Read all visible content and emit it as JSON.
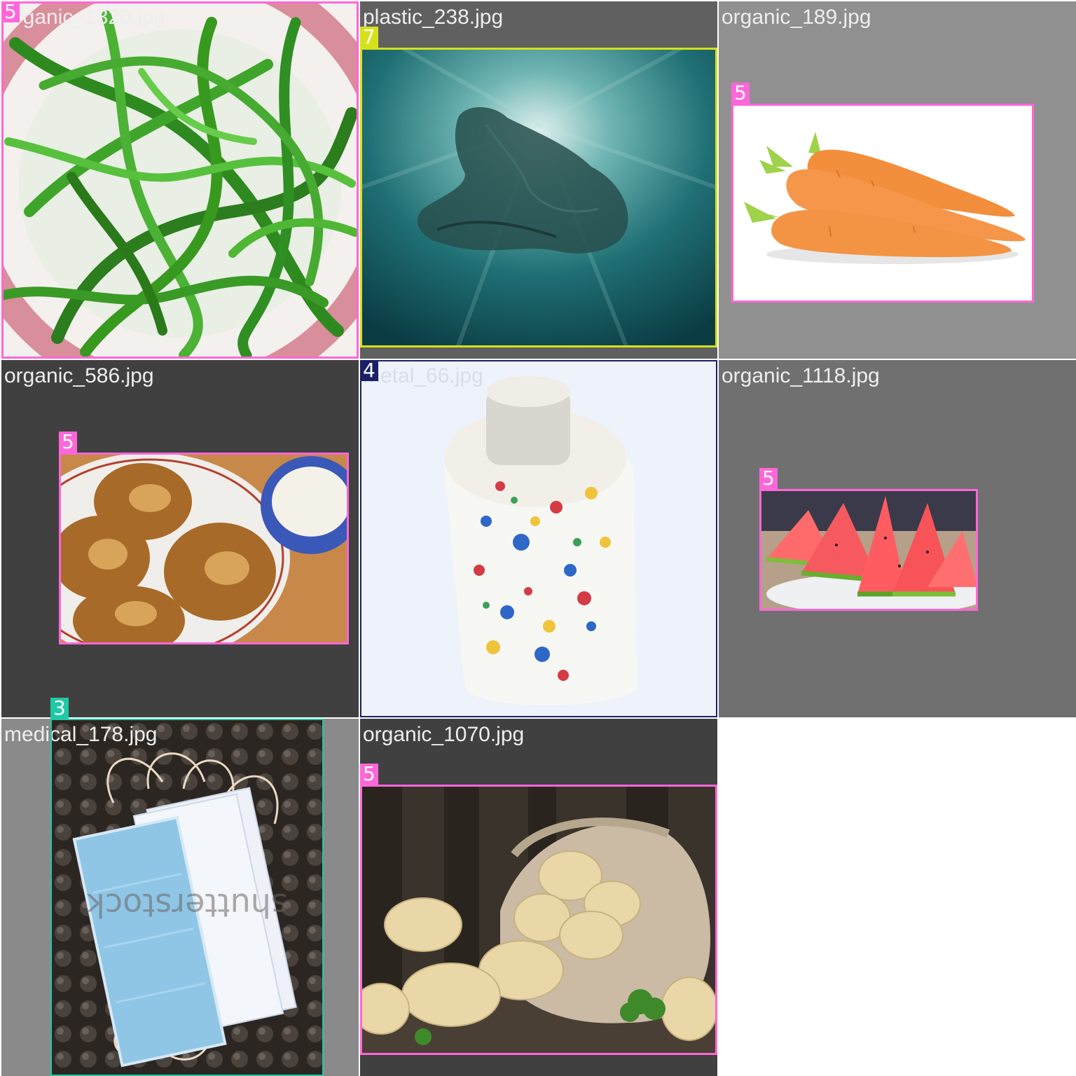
{
  "grid": {
    "tiles": [
      {
        "filename": "organic_1320.jpg",
        "bg": "#ffffff",
        "class_id": "5",
        "box_color": "#ff66d9",
        "subject": "green-beans"
      },
      {
        "filename": "plastic_238.jpg",
        "bg": "#606060",
        "class_id": "7",
        "box_color": "#d4e21a",
        "subject": "plastic-bag-underwater"
      },
      {
        "filename": "organic_189.jpg",
        "bg": "#909090",
        "class_id": "5",
        "box_color": "#ff66d9",
        "subject": "carrots"
      },
      {
        "filename": "organic_586.jpg",
        "bg": "#404040",
        "class_id": "5",
        "box_color": "#ff66d9",
        "subject": "fritters-with-sour-cream"
      },
      {
        "filename": "metal_66.jpg",
        "bg": "#eef3fb",
        "class_id": "4",
        "box_color": "#1a1f66",
        "subject": "spray-paint-can"
      },
      {
        "filename": "organic_1118.jpg",
        "bg": "#707070",
        "class_id": "5",
        "box_color": "#ff66d9",
        "subject": "watermelon-slices"
      },
      {
        "filename": "medical_178.jpg",
        "bg": "#8a8a8a",
        "class_id": "3",
        "box_color": "#1fc9a6",
        "subject": "surgical-masks"
      },
      {
        "filename": "organic_1070.jpg",
        "bg": "#404040",
        "class_id": "5",
        "box_color": "#ff66d9",
        "subject": "potatoes-in-sack"
      }
    ]
  }
}
